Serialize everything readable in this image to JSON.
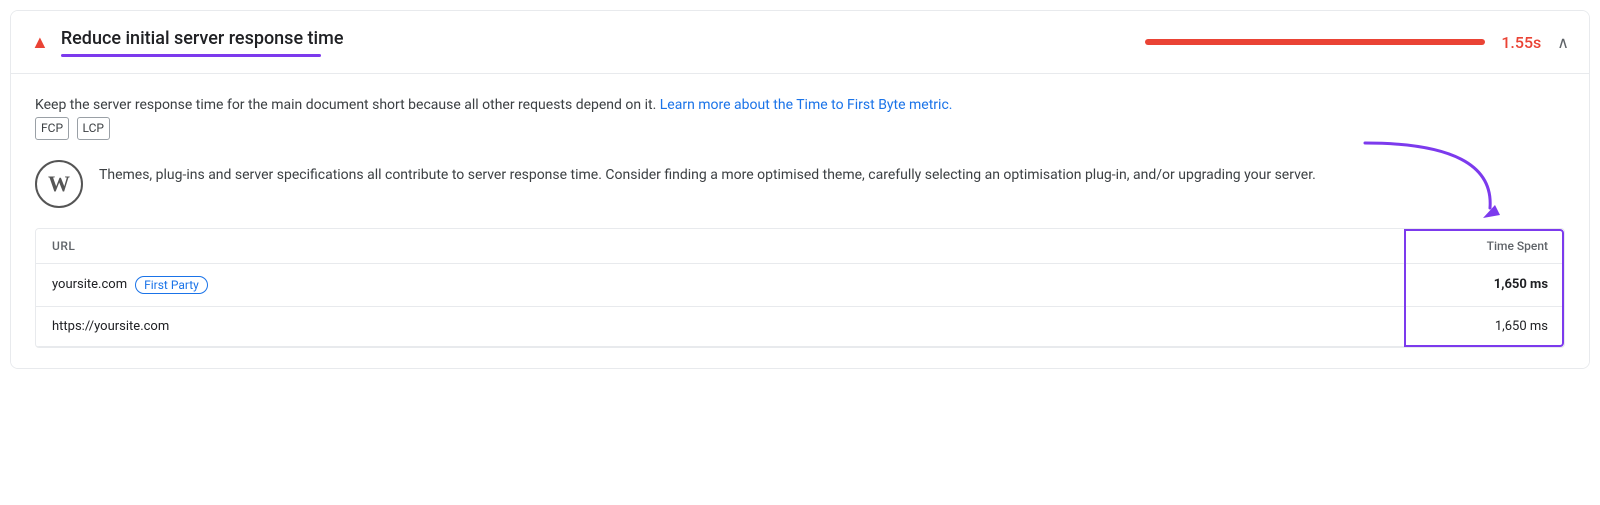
{
  "header": {
    "icon": "▲",
    "title": "Reduce initial server response time",
    "score": "1.55s",
    "chevron": "∧"
  },
  "description": {
    "text_before_link": "Keep the server response time for the main document short because all other requests depend on it. ",
    "link_text": "Learn more about the Time to First Byte metric.",
    "badges": [
      "FCP",
      "LCP"
    ]
  },
  "wordpress_hint": {
    "logo": "W",
    "text": "Themes, plug-ins and server specifications all contribute to server response time. Consider finding a more optimised theme, carefully selecting an optimisation plug-in, and/or upgrading your server."
  },
  "table": {
    "col_url_label": "URL",
    "col_time_label": "Time Spent",
    "rows": [
      {
        "url": "yoursite.com",
        "badge": "First Party",
        "time": "1,650 ms",
        "bold": true
      },
      {
        "url": "https://yoursite.com",
        "badge": null,
        "time": "1,650 ms",
        "bold": false
      }
    ]
  }
}
